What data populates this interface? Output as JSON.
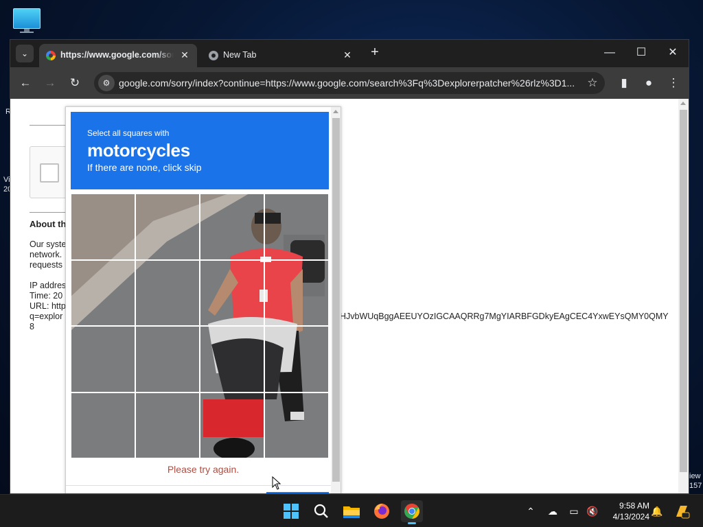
{
  "desktop": {
    "icon_name": "monitor-icon",
    "fragments_left": [
      "R",
      "Vi",
      "20"
    ],
    "fragments_right": [
      "iew",
      "157"
    ]
  },
  "browser": {
    "tabs": [
      {
        "title": "https://www.google.com/sorry/index?continue=https",
        "active": true,
        "close": "✕"
      },
      {
        "title": "New Tab",
        "active": false,
        "close": "✕"
      }
    ],
    "new_tab": "+",
    "window_controls": {
      "minimize": "—",
      "maximize": "☐",
      "close": "✕"
    },
    "address": "google.com/sorry/index?continue=https://www.google.com/search%3Fq%3Dexplorerpatcher%26rlz%3D1..."
  },
  "page": {
    "about_heading": "About th",
    "paragraph": [
      "Our syste",
      "network.",
      "requests"
    ],
    "info": [
      "IP addres",
      "Time: 20",
      "URL: http",
      "q=explor",
      "8"
    ],
    "query_fragment": "HJvbWUqBggAEEUYOzIGCAAQRRg7MgYIARBFGDkyEAgCEC4YxwEYsQMY0QMY"
  },
  "captcha": {
    "instruction_line1": "Select all squares with",
    "target_object": "motorcycles",
    "instruction_line3": "If there are none, click skip",
    "grid_rows": 4,
    "grid_cols": 4,
    "error_message": "Please try again.",
    "header_color": "#1a73e8",
    "error_color": "#b14c40"
  },
  "taskbar": {
    "apps": [
      "start",
      "search",
      "file-explorer",
      "firefox",
      "chrome"
    ],
    "active_app": "chrome",
    "clock_time": "9:58 AM",
    "clock_date": "4/13/2024"
  }
}
